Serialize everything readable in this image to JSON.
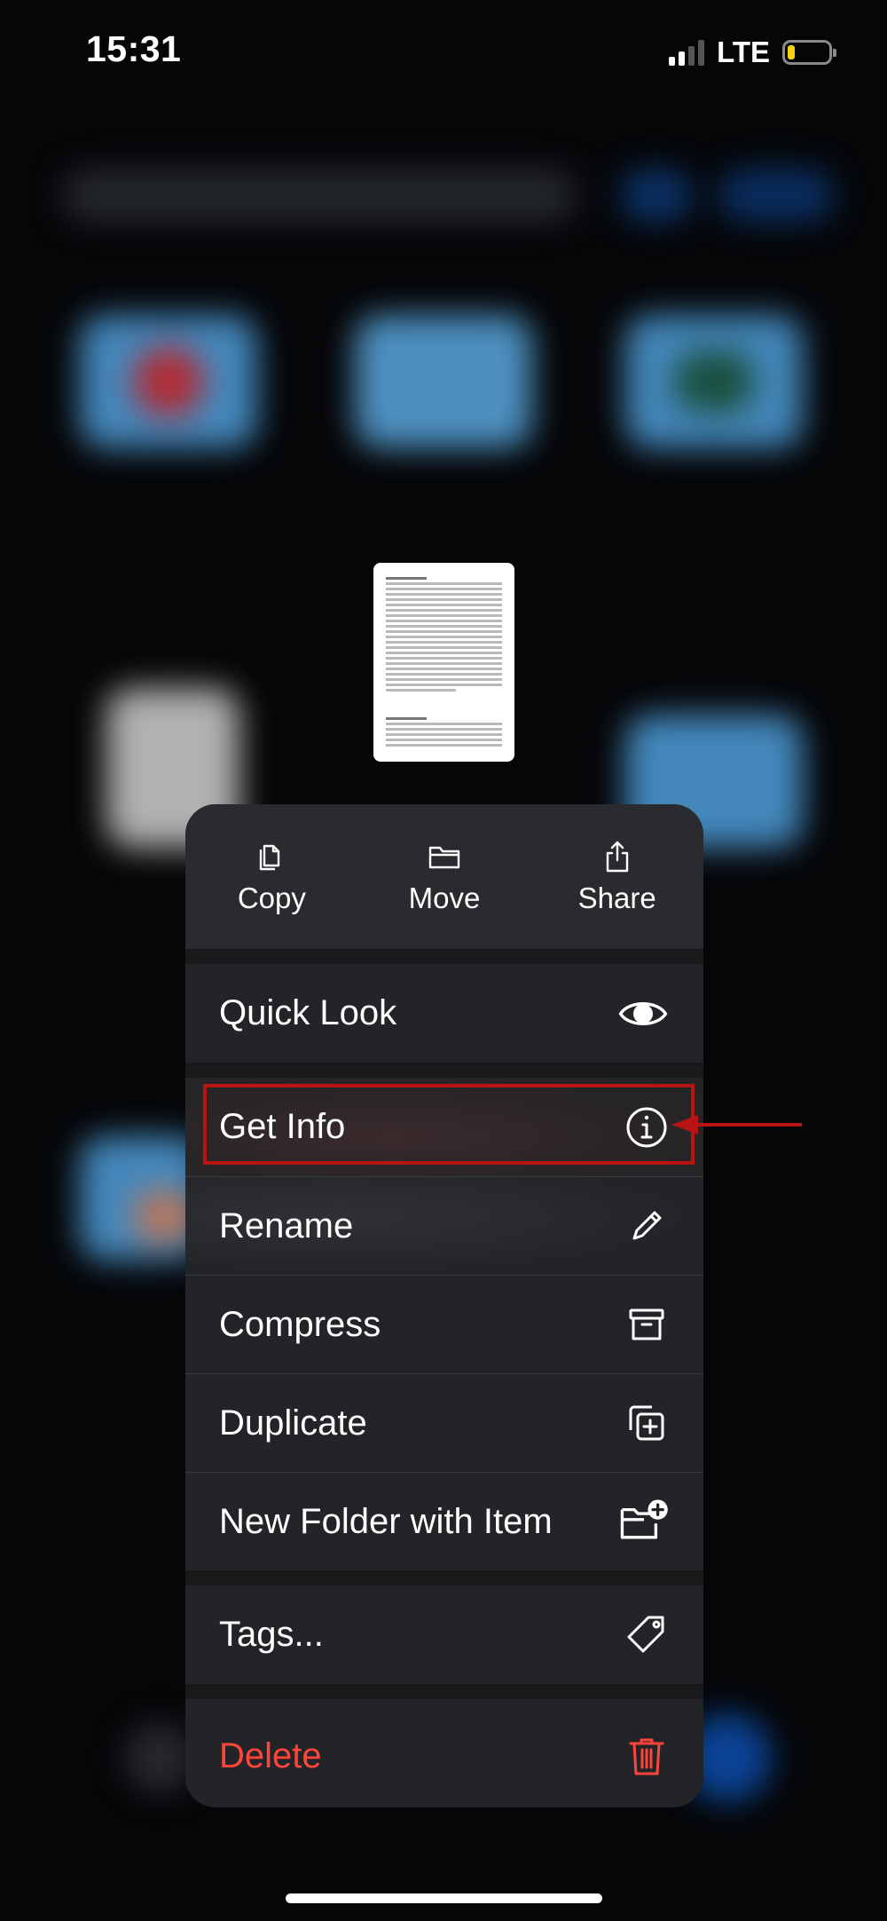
{
  "status_bar": {
    "time": "15:31",
    "network": "LTE",
    "signal_bars_active": 2,
    "signal_bars_total": 4,
    "battery_level_percent": 18
  },
  "colors": {
    "menu_background": "#232427",
    "delete_red": "#ff453a",
    "highlight_red": "#b81414",
    "battery_yellow": "#f5d311"
  },
  "actions": [
    {
      "label": "Copy",
      "icon": "copy-icon"
    },
    {
      "label": "Move",
      "icon": "folder-icon"
    },
    {
      "label": "Share",
      "icon": "share-icon"
    }
  ],
  "menu": {
    "quick_look": {
      "label": "Quick Look",
      "icon": "eye-icon"
    },
    "get_info": {
      "label": "Get Info",
      "icon": "info-icon"
    },
    "rename": {
      "label": "Rename",
      "icon": "pencil-icon"
    },
    "compress": {
      "label": "Compress",
      "icon": "archive-box-icon"
    },
    "duplicate": {
      "label": "Duplicate",
      "icon": "duplicate-icon"
    },
    "new_folder": {
      "label": "New Folder with Item",
      "icon": "folder-plus-icon"
    },
    "tags": {
      "label": "Tags...",
      "icon": "tag-icon"
    },
    "delete": {
      "label": "Delete",
      "icon": "trash-icon"
    }
  },
  "annotation": {
    "highlighted_item": "Get Info",
    "arrow_icon": "arrow-left-icon"
  }
}
